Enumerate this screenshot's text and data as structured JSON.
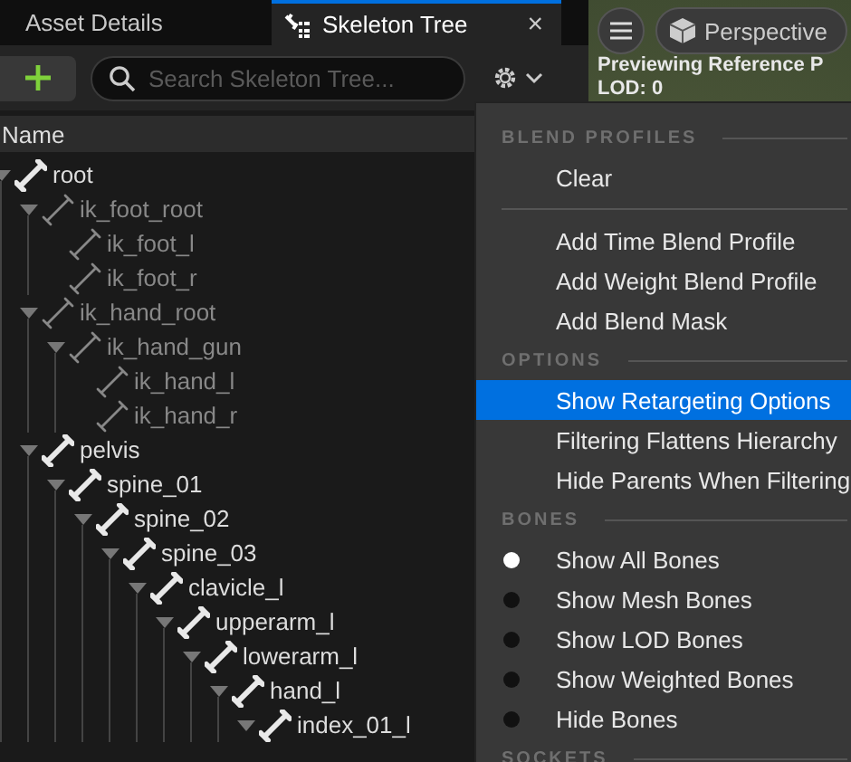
{
  "tabs": [
    {
      "label": "Asset Details",
      "selected": false
    },
    {
      "label": "Skeleton Tree",
      "selected": true,
      "close": "×"
    }
  ],
  "toolbar": {
    "search": {
      "placeholder": "Search Skeleton Tree..."
    }
  },
  "tree": {
    "column": "Name",
    "nodes": [
      {
        "name": "root",
        "virtual": false,
        "expanded": true,
        "children": [
          {
            "name": "ik_foot_root",
            "virtual": true,
            "expanded": true,
            "children": [
              {
                "name": "ik_foot_l",
                "virtual": true
              },
              {
                "name": "ik_foot_r",
                "virtual": true
              }
            ]
          },
          {
            "name": "ik_hand_root",
            "virtual": true,
            "expanded": true,
            "children": [
              {
                "name": "ik_hand_gun",
                "virtual": true,
                "expanded": true,
                "children": [
                  {
                    "name": "ik_hand_l",
                    "virtual": true
                  },
                  {
                    "name": "ik_hand_r",
                    "virtual": true
                  }
                ]
              }
            ]
          },
          {
            "name": "pelvis",
            "virtual": false,
            "expanded": true,
            "children": [
              {
                "name": "spine_01",
                "virtual": false,
                "expanded": true,
                "children": [
                  {
                    "name": "spine_02",
                    "virtual": false,
                    "expanded": true,
                    "children": [
                      {
                        "name": "spine_03",
                        "virtual": false,
                        "expanded": true,
                        "children": [
                          {
                            "name": "clavicle_l",
                            "virtual": false,
                            "expanded": true,
                            "children": [
                              {
                                "name": "upperarm_l",
                                "virtual": false,
                                "expanded": true,
                                "children": [
                                  {
                                    "name": "lowerarm_l",
                                    "virtual": false,
                                    "expanded": true,
                                    "children": [
                                      {
                                        "name": "hand_l",
                                        "virtual": false,
                                        "expanded": true,
                                        "children": [
                                          {
                                            "name": "index_01_l",
                                            "virtual": false,
                                            "expanded": true
                                          }
                                        ]
                                      }
                                    ]
                                  }
                                ]
                              }
                            ]
                          }
                        ]
                      }
                    ]
                  }
                ]
              }
            ]
          }
        ]
      }
    ]
  },
  "viewport": {
    "view_mode": "Perspective",
    "overlay_lines": [
      "Previewing Reference P",
      "LOD: 0"
    ]
  },
  "menu": {
    "sections": [
      {
        "header": "BLEND PROFILES",
        "items": [
          {
            "kind": "action",
            "label": "Clear",
            "highlighted": false
          },
          {
            "kind": "separator"
          },
          {
            "kind": "action",
            "label": "Add Time Blend Profile",
            "highlighted": false
          },
          {
            "kind": "action",
            "label": "Add Weight Blend Profile",
            "highlighted": false
          },
          {
            "kind": "action",
            "label": "Add Blend Mask",
            "highlighted": false
          }
        ]
      },
      {
        "header": "OPTIONS",
        "items": [
          {
            "kind": "check",
            "label": "Show Retargeting Options",
            "checked": false,
            "highlighted": true
          },
          {
            "kind": "check",
            "label": "Filtering Flattens Hierarchy",
            "checked": false,
            "highlighted": false
          },
          {
            "kind": "check",
            "label": "Hide Parents When Filtering",
            "checked": false,
            "highlighted": false
          }
        ]
      },
      {
        "header": "BONES",
        "items": [
          {
            "kind": "radio",
            "label": "Show All Bones",
            "selected": true,
            "highlighted": false
          },
          {
            "kind": "radio",
            "label": "Show Mesh Bones",
            "selected": false,
            "highlighted": false
          },
          {
            "kind": "radio",
            "label": "Show LOD Bones",
            "selected": false,
            "highlighted": false
          },
          {
            "kind": "radio",
            "label": "Show Weighted Bones",
            "selected": false,
            "highlighted": false
          },
          {
            "kind": "radio",
            "label": "Hide Bones",
            "selected": false,
            "highlighted": false
          }
        ]
      },
      {
        "header": "SOCKETS"
      }
    ]
  }
}
